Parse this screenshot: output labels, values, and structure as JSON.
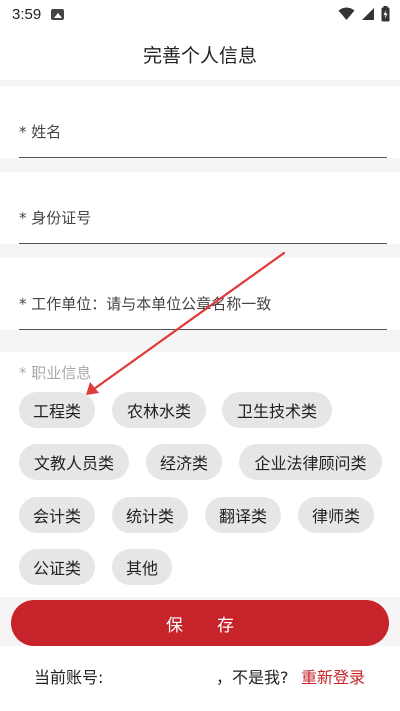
{
  "status_bar": {
    "time": "3:59"
  },
  "header": {
    "title": "完善个人信息"
  },
  "fields": {
    "name": {
      "label": "* 姓名"
    },
    "id_number": {
      "label": "* 身份证号"
    },
    "workplace": {
      "label": "* 工作单位：请与本单位公章名称一致"
    }
  },
  "profession": {
    "title": "* 职业信息",
    "chips": [
      "工程类",
      "农林水类",
      "卫生技术类",
      "文教人员类",
      "经济类",
      "企业法律顾问类",
      "会计类",
      "统计类",
      "翻译类",
      "律师类",
      "公证类",
      "其他"
    ]
  },
  "save_button": {
    "label": "保　　存"
  },
  "account": {
    "prefix": "当前账号:",
    "not_me": "，不是我?",
    "relogin": "重新登录"
  },
  "colors": {
    "accent": "#c6232a",
    "chip_bg": "#e6e6e6",
    "arrow": "#e03a3a"
  }
}
